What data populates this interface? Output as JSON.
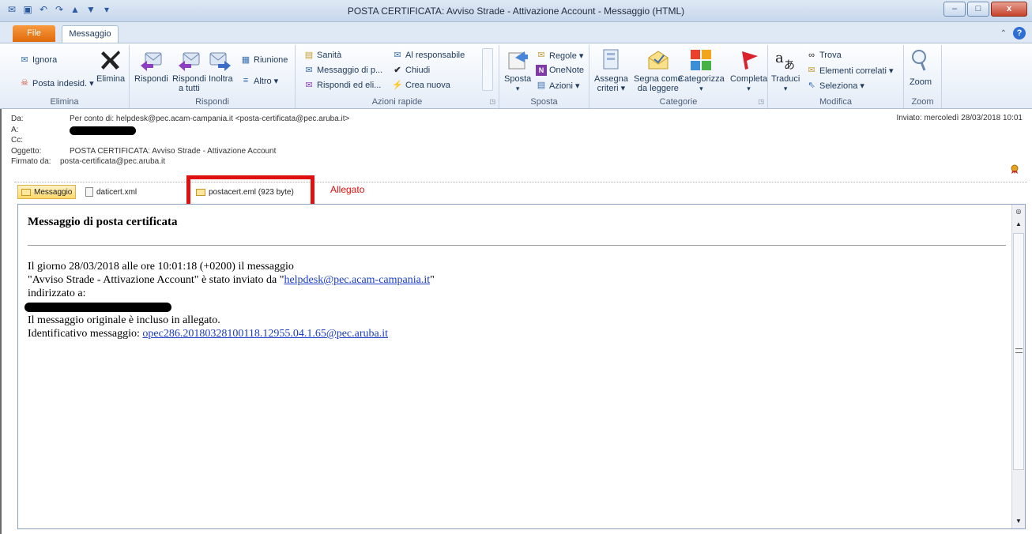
{
  "window": {
    "title": "POSTA CERTIFICATA: Avviso Strade - Attivazione Account  -  Messaggio (HTML)",
    "controls": [
      "–",
      "□",
      "x"
    ]
  },
  "tabs": {
    "file": "File",
    "message": "Messaggio"
  },
  "ribbon": {
    "elimina": {
      "label": "Elimina",
      "ignora": "Ignora",
      "posta_indesid": "Posta indesid. ▾",
      "elimina_btn": "Elimina"
    },
    "rispondi": {
      "label": "Rispondi",
      "rispondi": "Rispondi",
      "rispondi_tutti_1": "Rispondi",
      "rispondi_tutti_2": "a tutti",
      "inoltra": "Inoltra",
      "riunione": "Riunione",
      "altro": "Altro ▾"
    },
    "azioni_rapide": {
      "label": "Azioni rapide",
      "items": [
        "Sanità",
        "Messaggio di p...",
        "Rispondi ed eli...",
        "Al responsabile",
        "Chiudi",
        "Crea nuova"
      ]
    },
    "sposta": {
      "label": "Sposta",
      "sposta": "Sposta",
      "regole": "Regole ▾",
      "onenote": "OneNote",
      "azioni": "Azioni ▾"
    },
    "categorie": {
      "label": "Categorie",
      "assegna_1": "Assegna",
      "assegna_2": "criteri ▾",
      "segna_1": "Segna come",
      "segna_2": "da leggere",
      "categorizza": "Categorizza",
      "completa": "Completa"
    },
    "modifica": {
      "label": "Modifica",
      "traduci": "Traduci",
      "trova": "Trova",
      "elementi": "Elementi correlati ▾",
      "seleziona": "Seleziona ▾"
    },
    "zoom": {
      "label": "Zoom",
      "zoom": "Zoom"
    }
  },
  "header": {
    "da_label": "Da:",
    "da_value": "Per conto di: helpdesk@pec.acam-campania.it <posta-certificata@pec.aruba.it>",
    "a_label": "A:",
    "cc_label": "Cc:",
    "oggetto_label": "Oggetto:",
    "oggetto_value": "POSTA CERTIFICATA: Avviso Strade - Attivazione Account",
    "firmato_label": "Firmato da:",
    "firmato_value": "posta-certificata@pec.aruba.it",
    "inviato": "Inviato:  mercoledì 28/03/2018 10:01"
  },
  "attachments": {
    "messaggio": "Messaggio",
    "daticert": "daticert.xml",
    "postacert": "postacert.eml (923 byte)",
    "annotation": "Allegato"
  },
  "body": {
    "heading": "Messaggio di posta certificata",
    "line1": "Il giorno 28/03/2018 alle ore 10:01:18 (+0200) il messaggio",
    "line2_pre": "\"Avviso Strade - Attivazione Account\" è stato inviato da \"",
    "line2_link": "helpdesk@pec.acam-campania.it",
    "line2_post": "\"",
    "line3": "indirizzato a:",
    "line5": "Il messaggio originale è incluso in allegato.",
    "line6_pre": "Identificativo messaggio: ",
    "line6_link": "opec286.20180328100118.12955.04.1.65@pec.aruba.it"
  }
}
